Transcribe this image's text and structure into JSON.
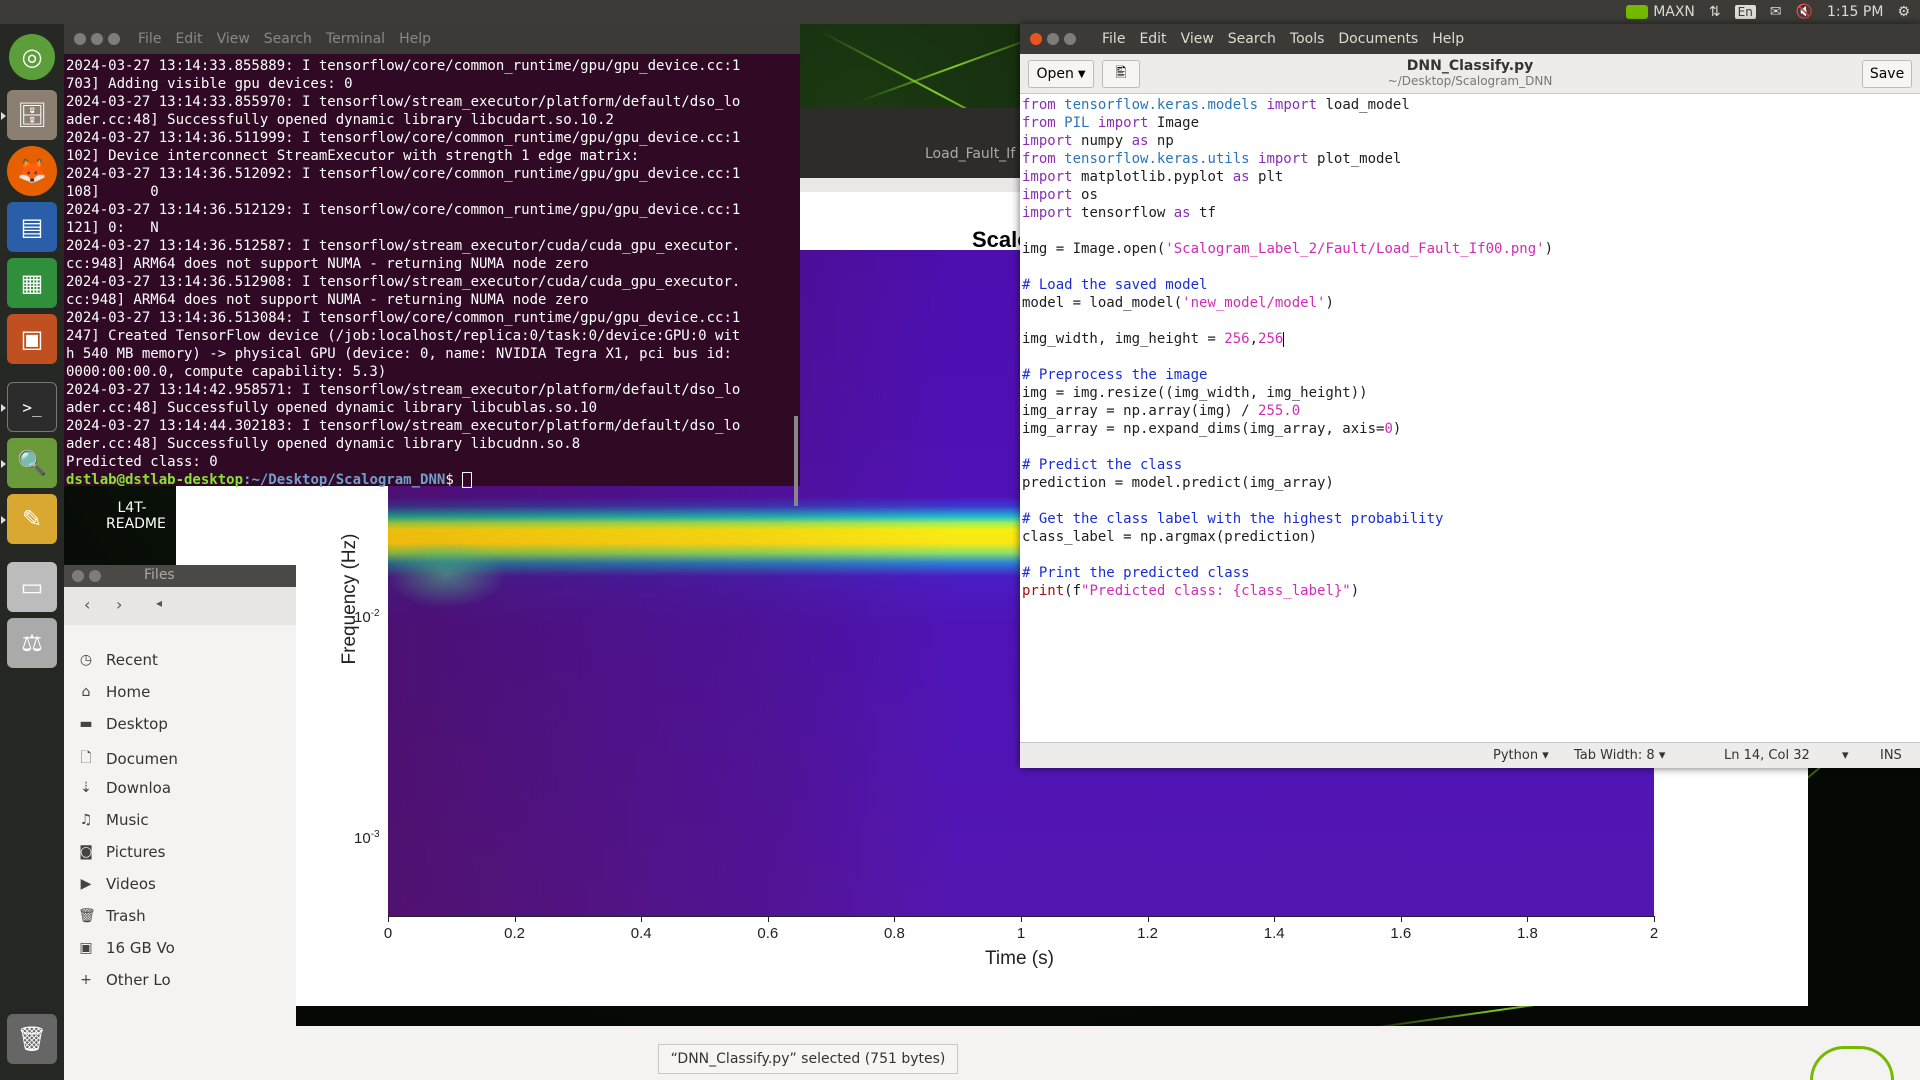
{
  "topbar": {
    "power_mode": "MAXN",
    "keyboard": "En",
    "time": "1:15 PM"
  },
  "launcher": {
    "items": [
      "ubuntu-icon",
      "files-icon",
      "firefox-icon",
      "writer-icon",
      "calc-icon",
      "impress-icon",
      "terminal-icon",
      "image-viewer-icon",
      "text-editor-icon",
      "drive-icon",
      "drive-icon",
      "trash-icon"
    ]
  },
  "desktop": {
    "readme_label_line1": "L4T-",
    "readme_label_line2": "README"
  },
  "plot": {
    "title_fragment": "Scalo",
    "window_label_fragment": "Load_Fault_If",
    "xlabel": "Time (s)",
    "ylabel": "Frequency (Hz)"
  },
  "chart_data": {
    "type": "heatmap",
    "title": "Scalo",
    "xlabel": "Time (s)",
    "ylabel": "Frequency (Hz)",
    "x_ticks": [
      "0",
      "0.2",
      "0.4",
      "0.6",
      "0.8",
      "1",
      "1.2",
      "1.4",
      "1.6",
      "1.8",
      "2"
    ],
    "xlim": [
      0,
      2
    ],
    "y_ticks": [
      "10-2",
      "10-3"
    ],
    "y_scale": "log",
    "notes": "single high-energy band (yellow) just above 10^-2 Hz across full time span"
  },
  "files": {
    "title": "Files",
    "sidebar": [
      "Recent",
      "Home",
      "Desktop",
      "Documen",
      "Downloa",
      "Music",
      "Pictures",
      "Videos",
      "Trash",
      "16 GB Vo",
      "Other Lo"
    ]
  },
  "terminal": {
    "menu": [
      "File",
      "Edit",
      "View",
      "Search",
      "Terminal",
      "Help"
    ],
    "lines": [
      "2024-03-27 13:14:33.855889: I tensorflow/core/common_runtime/gpu/gpu_device.cc:1",
      "703] Adding visible gpu devices: 0",
      "2024-03-27 13:14:33.855970: I tensorflow/stream_executor/platform/default/dso_lo",
      "ader.cc:48] Successfully opened dynamic library libcudart.so.10.2",
      "2024-03-27 13:14:36.511999: I tensorflow/core/common_runtime/gpu/gpu_device.cc:1",
      "102] Device interconnect StreamExecutor with strength 1 edge matrix:",
      "2024-03-27 13:14:36.512092: I tensorflow/core/common_runtime/gpu/gpu_device.cc:1",
      "108]      0",
      "2024-03-27 13:14:36.512129: I tensorflow/core/common_runtime/gpu/gpu_device.cc:1",
      "121] 0:   N",
      "2024-03-27 13:14:36.512587: I tensorflow/stream_executor/cuda/cuda_gpu_executor.",
      "cc:948] ARM64 does not support NUMA - returning NUMA node zero",
      "2024-03-27 13:14:36.512908: I tensorflow/stream_executor/cuda/cuda_gpu_executor.",
      "cc:948] ARM64 does not support NUMA - returning NUMA node zero",
      "2024-03-27 13:14:36.513084: I tensorflow/core/common_runtime/gpu/gpu_device.cc:1",
      "247] Created TensorFlow device (/job:localhost/replica:0/task:0/device:GPU:0 wit",
      "h 540 MB memory) -> physical GPU (device: 0, name: NVIDIA Tegra X1, pci bus id:",
      "0000:00:00.0, compute capability: 5.3)",
      "2024-03-27 13:14:42.958571: I tensorflow/stream_executor/platform/default/dso_lo",
      "ader.cc:48] Successfully opened dynamic library libcublas.so.10",
      "2024-03-27 13:14:44.302183: I tensorflow/stream_executor/platform/default/dso_lo",
      "ader.cc:48] Successfully opened dynamic library libcudnn.so.8",
      "Predicted class: 0"
    ],
    "prompt_user": "dstlab@dstlab-desktop",
    "prompt_path": ":~/Desktop/Scalogram_DNN",
    "prompt_symbol": "$ "
  },
  "editor": {
    "menu": [
      "File",
      "Edit",
      "View",
      "Search",
      "Tools",
      "Documents",
      "Help"
    ],
    "open_label": "Open",
    "save_label": "Save",
    "filename": "DNN_Classify.py",
    "filepath": "~/Desktop/Scalogram_DNN",
    "status": {
      "language": "Python",
      "tab_width": "Tab Width: 8",
      "position": "Ln 14, Col 32",
      "mode": "INS"
    }
  },
  "status_bar": {
    "selection": "“DNN_Classify.py” selected (751 bytes)"
  }
}
